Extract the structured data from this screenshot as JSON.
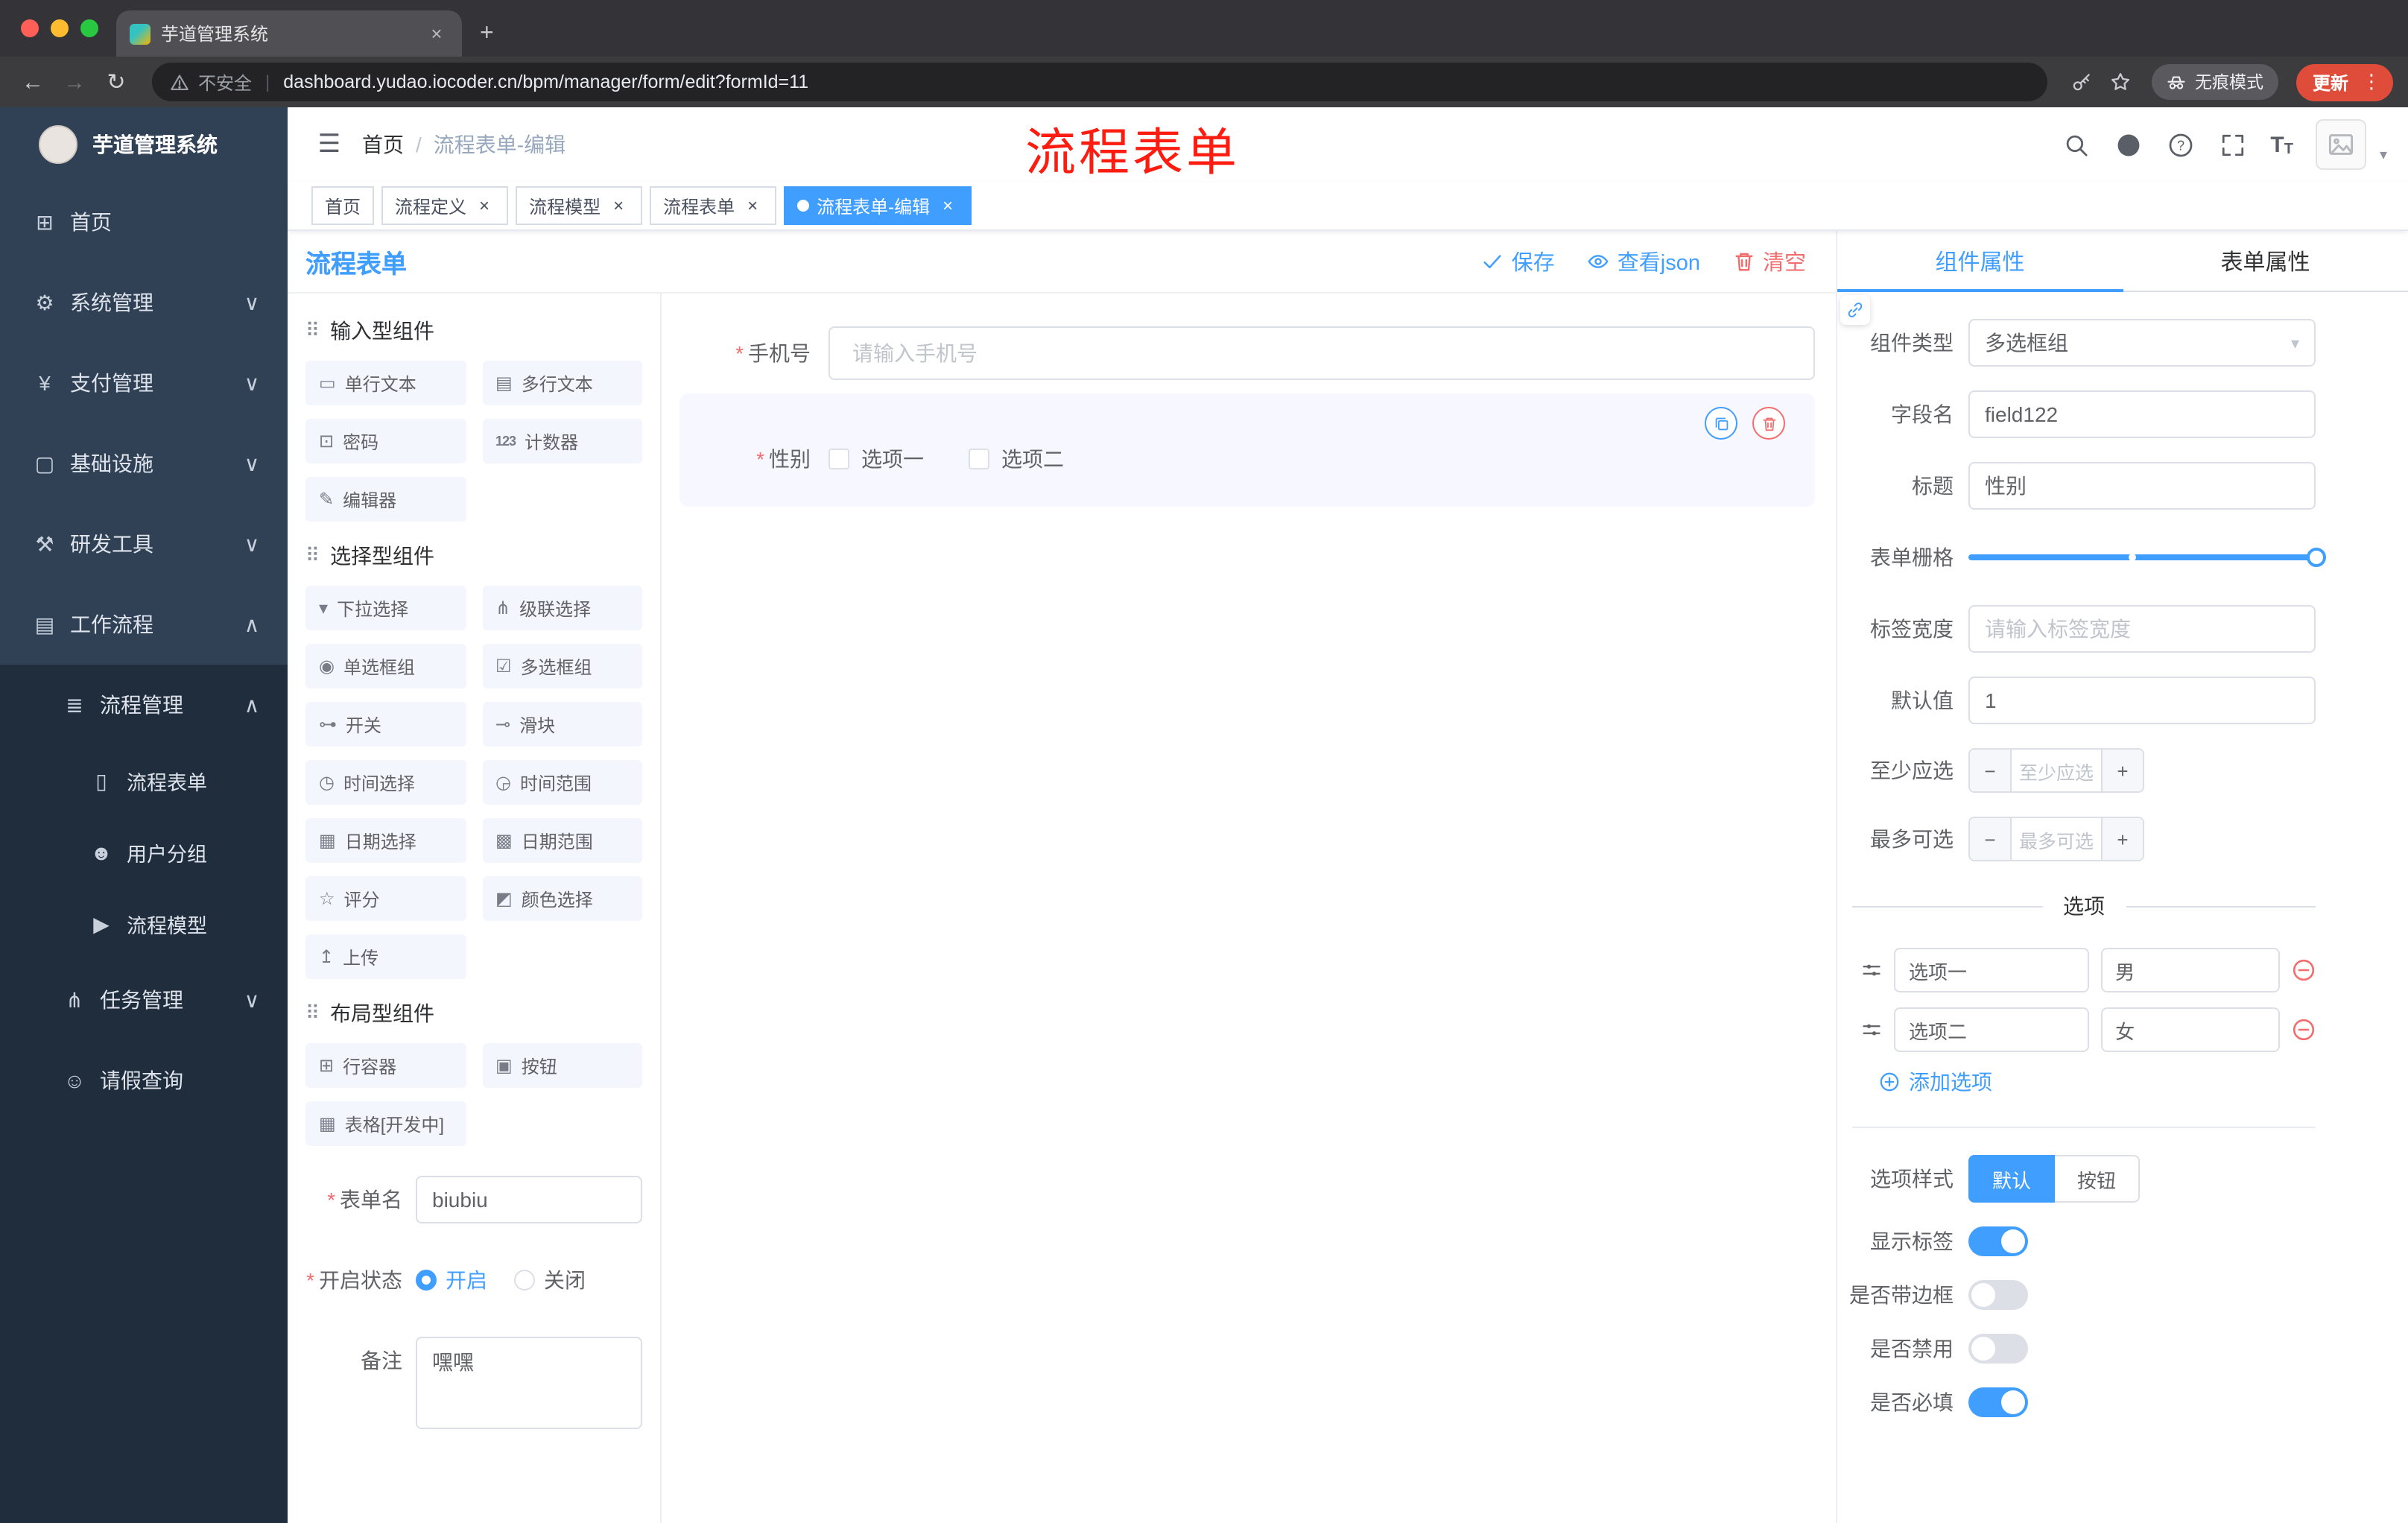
{
  "colors": {
    "accent": "#409eff",
    "danger": "#f56c6c",
    "annotation_red": "#fd1c10"
  },
  "icons": {
    "hamburger-icon": "☰",
    "home-icon": "⊞",
    "system-icon": "⚙",
    "payment-icon": "¥",
    "infra-icon": "▢",
    "devtools-icon": "⚒",
    "workflow-icon": "▤",
    "process-mgmt-icon": "≣",
    "process-form-icon": "▯",
    "user-group-icon": "☻",
    "process-model-icon": "▶",
    "task-mgmt-icon": "⋔",
    "leave-query-icon": "☺",
    "chevron-down-icon": "∨",
    "chevron-up-icon": "∧",
    "caret-down-icon": "▾",
    "back-icon": "←",
    "forward-icon": "→",
    "reload-icon": "↻",
    "plus-icon": "+",
    "close-icon": "×",
    "kebab-icon": "⋮",
    "minus-icon": "−",
    "input-icon": "▭",
    "textarea-icon": "▤",
    "password-icon": "⊡",
    "counter-icon": "123",
    "editor-icon": "✎",
    "select-icon": "▾",
    "cascader-icon": "⋔",
    "radio-group-icon": "◉",
    "checkbox-group-icon": "☑",
    "switch-icon": "⊶",
    "slider-icon": "⊸",
    "time-icon": "◷",
    "time-range-icon": "◶",
    "date-icon": "▦",
    "date-range-icon": "▩",
    "rate-icon": "☆",
    "color-icon": "◩",
    "upload-icon": "↥",
    "row-icon": "⊞",
    "button-icon": "▣",
    "table-icon": "▦",
    "group-icon": "⠿"
  },
  "browser": {
    "tab": {
      "title": "芋道管理系统"
    },
    "address": {
      "security": "不安全",
      "divider": "|",
      "url": "dashboard.yudao.iocoder.cn/bpm/manager/form/edit?formId=11"
    },
    "incognito_label": "无痕模式",
    "update_label": "更新"
  },
  "annotation": {
    "text": "流程表单"
  },
  "sidebar": {
    "logo_title": "芋道管理系统",
    "items": [
      {
        "label": "首页"
      },
      {
        "label": "系统管理"
      },
      {
        "label": "支付管理"
      },
      {
        "label": "基础设施"
      },
      {
        "label": "研发工具"
      },
      {
        "label": "工作流程"
      },
      {
        "label": "流程管理"
      },
      {
        "label": "流程表单"
      },
      {
        "label": "用户分组"
      },
      {
        "label": "流程模型"
      },
      {
        "label": "任务管理"
      },
      {
        "label": "请假查询"
      }
    ]
  },
  "header": {
    "breadcrumb": {
      "home": "首页",
      "separator": "/",
      "current": "流程表单-编辑"
    }
  },
  "tags": [
    {
      "label": "首页"
    },
    {
      "label": "流程定义"
    },
    {
      "label": "流程模型"
    },
    {
      "label": "流程表单"
    },
    {
      "label": "流程表单-编辑"
    }
  ],
  "workspace": {
    "title": "流程表单",
    "save_label": "保存",
    "view_json_label": "查看json",
    "clear_label": "清空"
  },
  "palette": {
    "groups": [
      {
        "title": "输入型组件",
        "items": [
          {
            "label": "单行文本"
          },
          {
            "label": "多行文本"
          },
          {
            "label": "密码"
          },
          {
            "label": "计数器"
          },
          {
            "label": "编辑器"
          }
        ]
      },
      {
        "title": "选择型组件",
        "items": [
          {
            "label": "下拉选择"
          },
          {
            "label": "级联选择"
          },
          {
            "label": "单选框组"
          },
          {
            "label": "多选框组"
          },
          {
            "label": "开关"
          },
          {
            "label": "滑块"
          },
          {
            "label": "时间选择"
          },
          {
            "label": "时间范围"
          },
          {
            "label": "日期选择"
          },
          {
            "label": "日期范围"
          },
          {
            "label": "评分"
          },
          {
            "label": "颜色选择"
          },
          {
            "label": "上传"
          }
        ]
      },
      {
        "title": "布局型组件",
        "items": [
          {
            "label": "行容器"
          },
          {
            "label": "按钮"
          },
          {
            "label": "表格[开发中]"
          }
        ]
      }
    ]
  },
  "form_config": {
    "name_label": "表单名",
    "name_value": "biubiu",
    "status_label": "开启状态",
    "status_on": "开启",
    "status_off": "关闭",
    "remark_label": "备注",
    "remark_value": "嘿嘿"
  },
  "canvas": {
    "phone": {
      "label": "手机号",
      "placeholder": "请输入手机号"
    },
    "gender": {
      "label": "性别",
      "options": [
        {
          "label": "选项一"
        },
        {
          "label": "选项二"
        }
      ]
    }
  },
  "props": {
    "tabs": {
      "component": "组件属性",
      "form": "表单属性"
    },
    "component_type": {
      "label": "组件类型",
      "value": "多选框组"
    },
    "field_name": {
      "label": "字段名",
      "value": "field122"
    },
    "title": {
      "label": "标题",
      "value": "性别"
    },
    "grid": {
      "label": "表单栅格"
    },
    "label_width": {
      "label": "标签宽度",
      "placeholder": "请输入标签宽度"
    },
    "default_value": {
      "label": "默认值",
      "value": "1"
    },
    "min_select": {
      "label": "至少应选",
      "placeholder": "至少应选"
    },
    "max_select": {
      "label": "最多可选",
      "placeholder": "最多可选"
    },
    "options_divider": "选项",
    "options": [
      {
        "name": "选项一",
        "value": "男"
      },
      {
        "name": "选项二",
        "value": "女"
      }
    ],
    "add_option_label": "添加选项",
    "option_style": {
      "label": "选项样式",
      "default": "默认",
      "button": "按钮"
    },
    "show_label": {
      "label": "显示标签",
      "value": true
    },
    "border": {
      "label": "是否带边框",
      "value": false
    },
    "disabled": {
      "label": "是否禁用",
      "value": false
    },
    "required": {
      "label": "是否必填",
      "value": true
    }
  }
}
